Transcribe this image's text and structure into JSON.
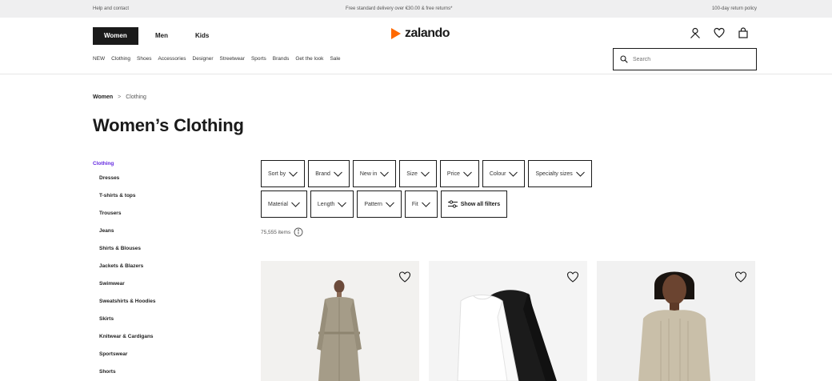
{
  "topbar": {
    "left": "Help and contact",
    "middle": "Free standard delivery over €30.00 & free returns*",
    "right": "100-day return policy"
  },
  "header": {
    "genders": [
      "Women",
      "Men",
      "Kids"
    ],
    "logo_text": "zalando"
  },
  "nav": {
    "items": [
      "NEW",
      "Clothing",
      "Shoes",
      "Accessories",
      "Designer",
      "Streetwear",
      "Sports",
      "Brands",
      "Get the look",
      "Sale"
    ]
  },
  "search": {
    "placeholder": "Search"
  },
  "breadcrumb": {
    "root": "Women",
    "separator": ">",
    "current": "Clothing"
  },
  "page": {
    "title": "Women’s Clothing"
  },
  "sidebar": {
    "heading": "Clothing",
    "items": [
      "Dresses",
      "T-shirts & tops",
      "Trousers",
      "Jeans",
      "Shirts & Blouses",
      "Jackets & Blazers",
      "Swimwear",
      "Sweatshirts & Hoodies",
      "Skirts",
      "Knitwear & Cardigans",
      "Sportswear",
      "Shorts"
    ]
  },
  "filters": {
    "row1": [
      "Sort by",
      "Brand",
      "New in",
      "Size",
      "Price",
      "Colour",
      "Specialty sizes"
    ],
    "row2": [
      "Material",
      "Length",
      "Pattern",
      "Fit"
    ],
    "show_all": "Show all filters"
  },
  "results": {
    "count_text": "75,555 items"
  },
  "colors": {
    "accent": "#6328e0",
    "brand_orange": "#ff6900",
    "dark": "#1a1a1a"
  }
}
